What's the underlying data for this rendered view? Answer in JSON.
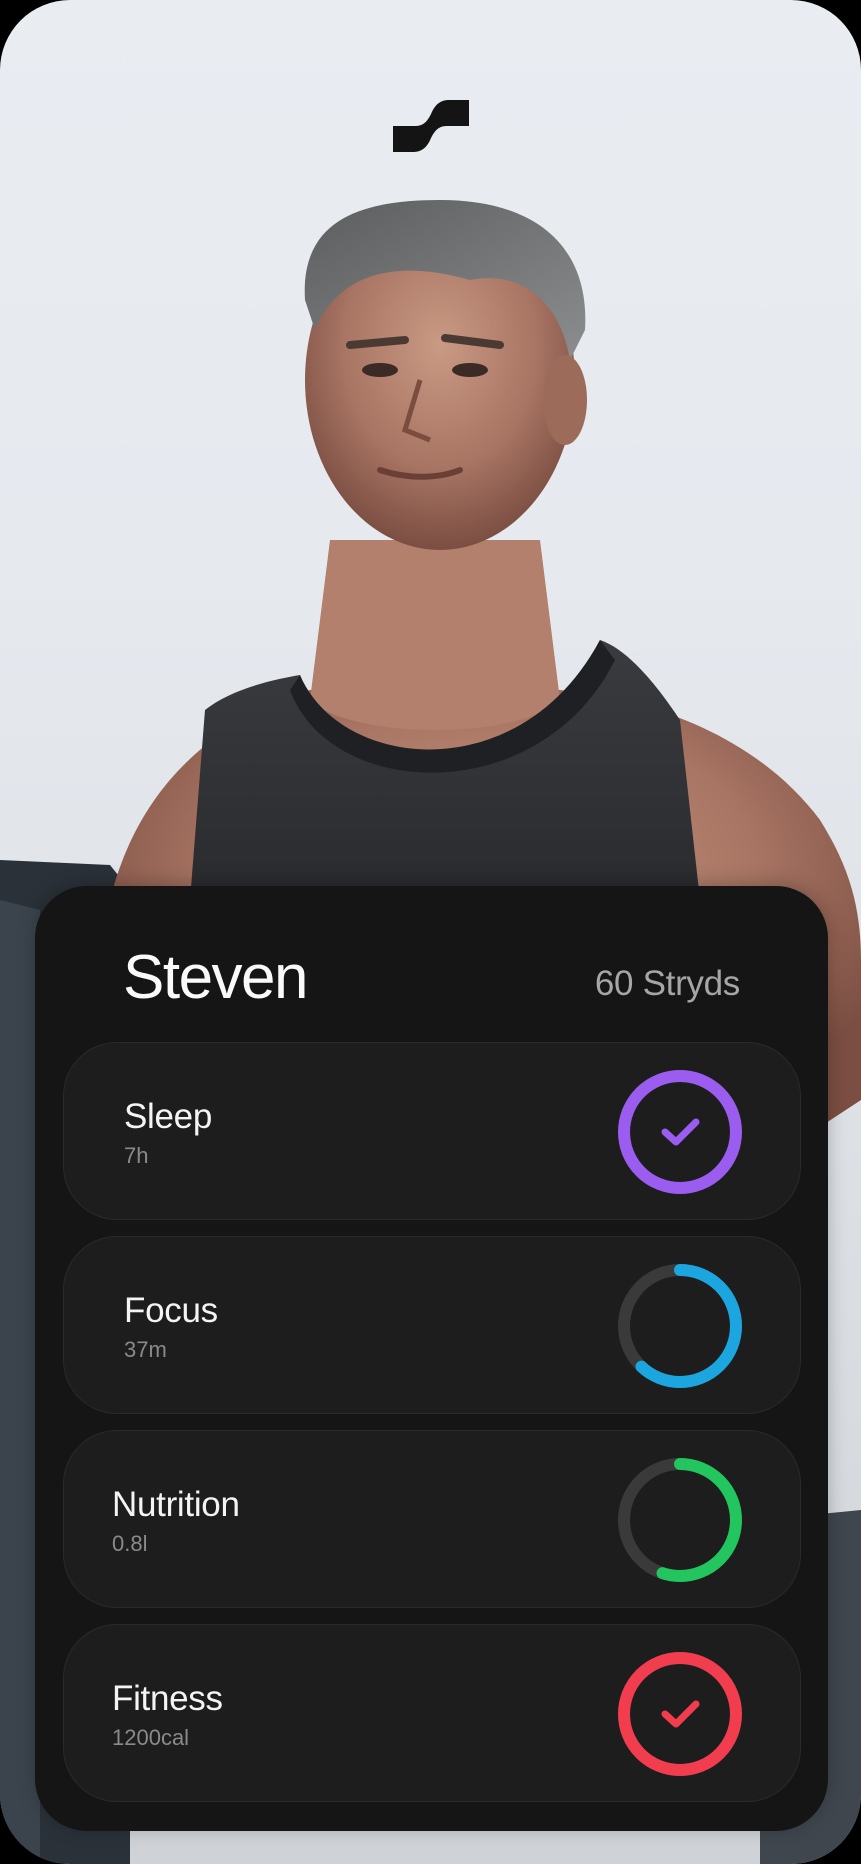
{
  "profile": {
    "name": "Steven",
    "points": "60 Stryds"
  },
  "logo": {
    "icon": "brand-logo-icon"
  },
  "metrics": [
    {
      "title": "Sleep",
      "value": "7h",
      "color": "#9b5cf0",
      "progress": 1.0,
      "complete": true
    },
    {
      "title": "Focus",
      "value": "37m",
      "color": "#1ca6e0",
      "progress": 0.62,
      "complete": false
    },
    {
      "title": "Nutrition",
      "value": "0.8l",
      "color": "#22c55e",
      "progress": 0.55,
      "complete": false
    },
    {
      "title": "Fitness",
      "value": "1200cal",
      "color": "#f23d4f",
      "progress": 1.0,
      "complete": true
    }
  ],
  "colors": {
    "card_bg": "#151515",
    "row_bg": "#1d1d1d",
    "ring_track": "#3a3a3a"
  }
}
